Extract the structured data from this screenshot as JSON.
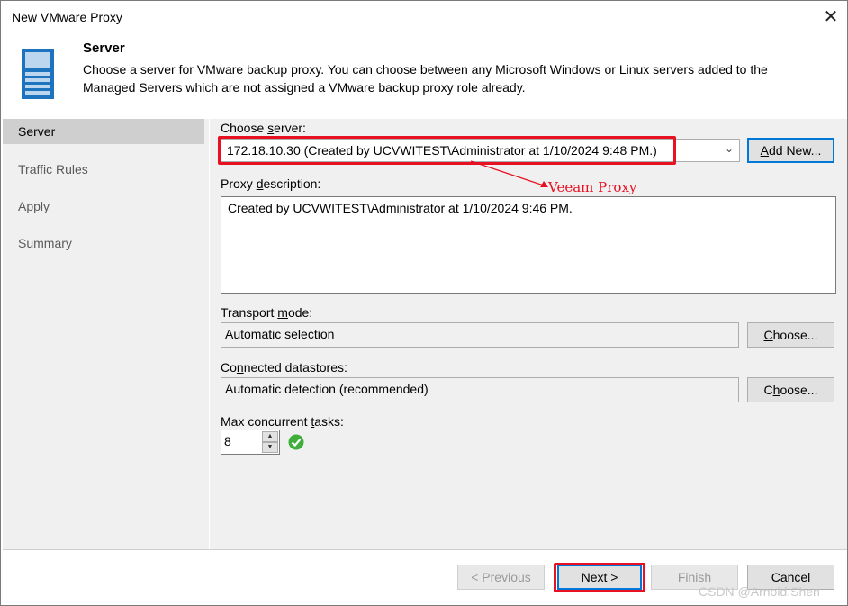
{
  "window": {
    "title": "New VMware Proxy",
    "close_glyph": "✕"
  },
  "header": {
    "title": "Server",
    "description": "Choose a server for VMware backup proxy. You can choose between any Microsoft Windows or Linux servers added to the Managed Servers which are not assigned a VMware backup proxy role already.",
    "icon": "server-icon"
  },
  "nav": {
    "items": [
      {
        "label": "Server",
        "active": true
      },
      {
        "label": "Traffic Rules",
        "active": false
      },
      {
        "label": "Apply",
        "active": false
      },
      {
        "label": "Summary",
        "active": false
      }
    ]
  },
  "form": {
    "choose_server": {
      "label_pre": "Choose ",
      "label_u": "s",
      "label_post": "erver:",
      "value": "172.18.10.30 (Created by UCVWITEST\\Administrator at 1/10/2024 9:48 PM.)",
      "add_new_pre": "",
      "add_new_u": "A",
      "add_new_post": "dd New..."
    },
    "proxy_description": {
      "label_pre": "Proxy ",
      "label_u": "d",
      "label_post": "escription:",
      "value": "Created by UCVWITEST\\Administrator at 1/10/2024 9:46 PM."
    },
    "transport_mode": {
      "label_pre": "Transport ",
      "label_u": "m",
      "label_post": "ode:",
      "value": "Automatic selection",
      "button_u": "C",
      "button_post": "hoose..."
    },
    "connected_datastores": {
      "label_pre": "Co",
      "label_u": "n",
      "label_post": "nected datastores:",
      "value": "Automatic detection (recommended)",
      "button_pre": "C",
      "button_u": "h",
      "button_post": "oose..."
    },
    "max_tasks": {
      "label_pre": "Max concurrent ",
      "label_u": "t",
      "label_post": "asks:",
      "value": "8",
      "status_icon": "check-circle-icon",
      "status_color": "#3fae3a"
    }
  },
  "footer": {
    "previous": {
      "pre": "< ",
      "u": "P",
      "post": "revious"
    },
    "next": {
      "u": "N",
      "post": "ext >"
    },
    "finish": {
      "u": "F",
      "post": "inish"
    },
    "cancel": "Cancel"
  },
  "annotation": {
    "text": "Veeam Proxy",
    "color": "#e81123"
  },
  "watermark": "CSDN @Arnold.Shen",
  "colors": {
    "accent": "#0078d7",
    "highlight": "#e81123",
    "pane_bg": "#f0f0f0",
    "nav_active": "#cfcfcf"
  }
}
